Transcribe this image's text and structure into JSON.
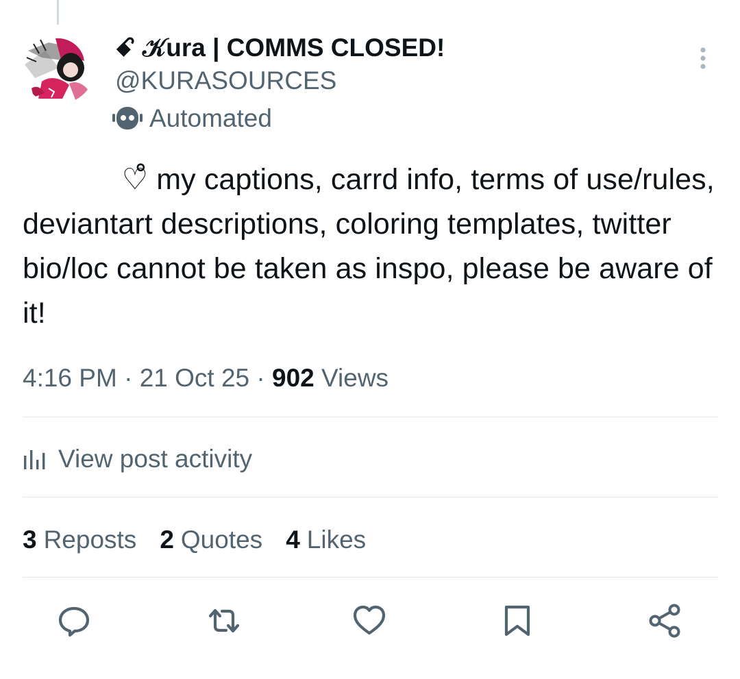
{
  "post": {
    "author": {
      "display_name": "ꗃ 𝒦ura | COMMS CLOSED!",
      "handle": "@KURASOURCES",
      "label": "Automated",
      "label_icon": "robot-icon",
      "avatar": "anime-character-avatar"
    },
    "menu_icon": "more-vertical-icon",
    "text": "            ♡̊ my captions, carrd info, terms of use/rules, deviantart descriptions, coloring templates, twitter bio/loc cannot be taken as inspo, please be aware of it!",
    "time": "4:16 PM",
    "separator": "·",
    "date": "21 Oct 25",
    "views_count": "902",
    "views_label": "Views"
  },
  "activity": {
    "label": "View post activity",
    "icon": "bar-chart-icon"
  },
  "stats": [
    {
      "count": "3",
      "label": "Reposts"
    },
    {
      "count": "2",
      "label": "Quotes"
    },
    {
      "count": "4",
      "label": "Likes"
    }
  ],
  "actions": [
    {
      "name": "reply",
      "icon": "reply-icon"
    },
    {
      "name": "repost",
      "icon": "repost-icon"
    },
    {
      "name": "like",
      "icon": "heart-icon"
    },
    {
      "name": "bookmark",
      "icon": "bookmark-icon"
    },
    {
      "name": "share",
      "icon": "share-icon"
    }
  ],
  "colors": {
    "text_primary": "#0f1419",
    "text_secondary": "#536471",
    "divider": "#e1e8ed",
    "avatar_accent": "#d6245f"
  }
}
